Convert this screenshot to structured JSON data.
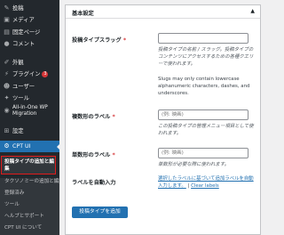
{
  "sidebar": {
    "items": [
      {
        "icon": "pin",
        "label": "投稿"
      },
      {
        "icon": "media",
        "label": "メディア"
      },
      {
        "icon": "page",
        "label": "固定ページ"
      },
      {
        "icon": "comment",
        "label": "コメント"
      },
      {
        "icon": "brush",
        "label": "外観"
      },
      {
        "icon": "plugin",
        "label": "プラグイン",
        "badge": "3"
      },
      {
        "icon": "user",
        "label": "ユーザー"
      },
      {
        "icon": "wrench",
        "label": "ツール"
      },
      {
        "icon": "migrate",
        "label": "All-in-One WP Migration"
      },
      {
        "icon": "settings",
        "label": "設定"
      },
      {
        "icon": "cpt",
        "label": "CPT UI"
      }
    ],
    "submenu": {
      "current": "投稿タイプの追加と編集",
      "items": [
        "タクソノミーの追加と編集",
        "登録済み",
        "ツール",
        "ヘルプとサポート",
        "CPT UI について"
      ]
    }
  },
  "panel": {
    "title": "基本設定",
    "fields": {
      "slug": {
        "label": "投稿タイプスラッグ",
        "required": "*",
        "help": "投稿タイプの名前 / スラッグ。投稿タイプのコンテンツにアクセスするための各種クエリーで使われます。",
        "note": "Slugs may only contain lowercase alphanumeric characters, dashes, and underscores."
      },
      "plural": {
        "label": "複数形のラベル",
        "required": "*",
        "placeholder": "(例: 映画)",
        "help": "この投稿タイプの管理メニュー項目として使われます。"
      },
      "singular": {
        "label": "単数形のラベル",
        "required": "*",
        "placeholder": "(例: 映画)",
        "help": "単数形が必要な際に使われます。"
      },
      "autofill": {
        "label": "ラベルを自動入力",
        "link1": "選択したラベルに基づいて追加ラベルを自動入力します。",
        "separator": "|",
        "link2": "Clear labels"
      }
    },
    "submit_label": "投稿タイプを追加"
  }
}
